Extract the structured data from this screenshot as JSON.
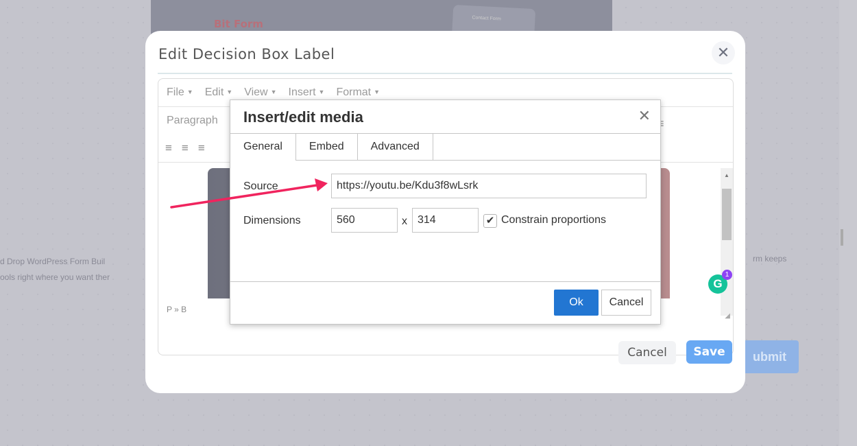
{
  "background": {
    "card_title": "Bit Form",
    "card_thumb_text": "Contact Form",
    "left_text": [
      "d Drop WordPress Form Buil",
      "ools right where you want ther"
    ],
    "right_text": "rm keeps",
    "submit_label": "ubmit"
  },
  "modal": {
    "title": "Edit Decision Box Label",
    "close_glyph": "✕",
    "cancel_label": "Cancel",
    "save_label": "Save"
  },
  "editor": {
    "menu": [
      "File",
      "Edit",
      "View",
      "Insert",
      "Format"
    ],
    "block_format": "Paragraph",
    "statusbar": "P » B",
    "grammarly_badge": "1",
    "grammarly_letter": "G"
  },
  "dialog": {
    "title": "Insert/edit media",
    "close_glyph": "✕",
    "tabs": [
      "General",
      "Embed",
      "Advanced"
    ],
    "active_tab": "General",
    "source_label": "Source",
    "source_value": "https://youtu.be/Kdu3f8wLsrk",
    "dimensions_label": "Dimensions",
    "width_value": "560",
    "height_value": "314",
    "separator": "x",
    "constrain_label": "Constrain proportions",
    "constrain_checked": true,
    "ok_label": "Ok",
    "cancel_label": "Cancel"
  },
  "annotation": {
    "arrow_color": "#f0245e"
  }
}
